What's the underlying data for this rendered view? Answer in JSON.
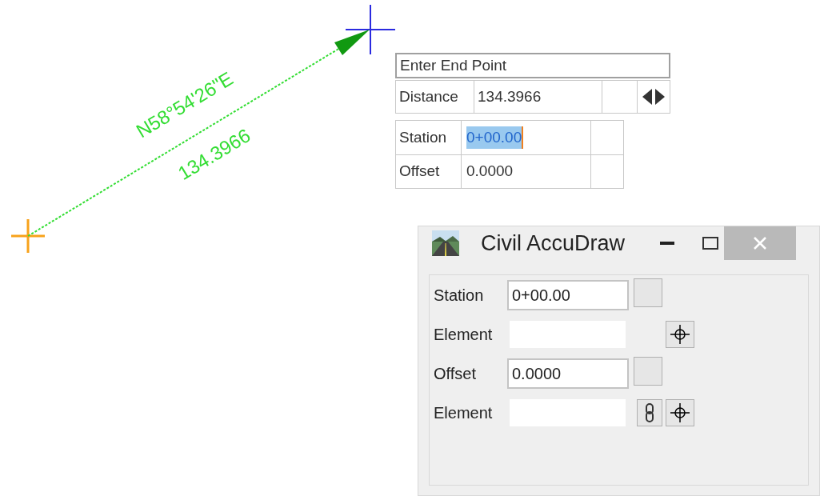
{
  "drawing": {
    "bearing": "N58°54'26\"E",
    "distance": "134.3966"
  },
  "prompt": {
    "title": "Enter End Point",
    "fields": [
      {
        "label": "Distance",
        "value": "134.3966"
      }
    ],
    "stations": [
      {
        "label": "Station",
        "value": "0+00.00",
        "selected": true
      },
      {
        "label": "Offset",
        "value": "0.0000",
        "selected": false
      }
    ]
  },
  "dialog": {
    "title": "Civil AccuDraw",
    "rows": [
      {
        "kind": "input",
        "label": "Station",
        "value": "0+00.00"
      },
      {
        "kind": "pick",
        "label": "Element"
      },
      {
        "kind": "input",
        "label": "Offset",
        "value": "0.0000"
      },
      {
        "kind": "linked-pick",
        "label": "Element"
      }
    ]
  }
}
